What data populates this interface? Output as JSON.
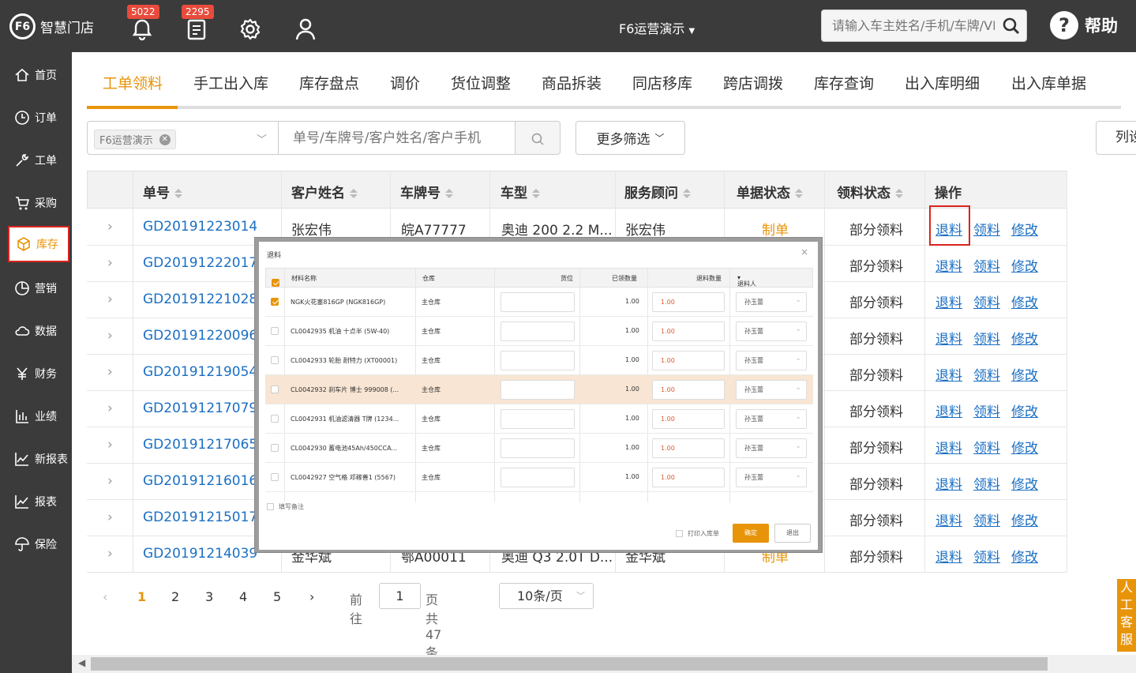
{
  "header": {
    "brand": "智慧门店",
    "brand_mark": "F6",
    "notifications_count": "5022",
    "tasks_count": "2295",
    "store": "F6运营演示",
    "search_placeholder": "请输入车主姓名/手机/车牌/VIN",
    "help_label": "帮助"
  },
  "sidebar": {
    "items": [
      {
        "label": "首页",
        "icon": "home-icon"
      },
      {
        "label": "订单",
        "icon": "clock-icon"
      },
      {
        "label": "工单",
        "icon": "wrench-icon"
      },
      {
        "label": "采购",
        "icon": "cart-icon"
      },
      {
        "label": "库存",
        "icon": "box-icon",
        "active": true
      },
      {
        "label": "营销",
        "icon": "pie-icon"
      },
      {
        "label": "数据",
        "icon": "cloud-icon"
      },
      {
        "label": "财务",
        "icon": "yen-icon"
      },
      {
        "label": "业绩",
        "icon": "bar-chart-icon"
      },
      {
        "label": "新报表",
        "icon": "line-chart-icon"
      },
      {
        "label": "报表",
        "icon": "line-chart-icon"
      },
      {
        "label": "保险",
        "icon": "umbrella-icon"
      }
    ]
  },
  "tabs": [
    "工单领料",
    "手工出入库",
    "库存盘点",
    "调价",
    "货位调整",
    "商品拆装",
    "同店移库",
    "跨店调拨",
    "库存查询",
    "出入库明细",
    "出入库单据"
  ],
  "filters": {
    "store_chip": "F6运营演示",
    "search_placeholder": "单号/车牌号/客户姓名/客户手机",
    "more_label": "更多筛选",
    "columns_label": "列设"
  },
  "table": {
    "headers": [
      "单号",
      "客户姓名",
      "车牌号",
      "车型",
      "服务顾问",
      "单据状态",
      "领料状态",
      "操作"
    ],
    "rows": [
      {
        "order": "GD20191223014",
        "customer": "张宏伟",
        "plate": "皖A77777",
        "model": "奥迪 200 2.2 M...",
        "advisor": "张宏伟",
        "status": "制单",
        "pick": "部分领料"
      },
      {
        "order": "GD20191222017",
        "customer": "",
        "plate": "",
        "model": "",
        "advisor": "",
        "status": "",
        "pick": "部分领料"
      },
      {
        "order": "GD20191221028",
        "customer": "",
        "plate": "",
        "model": "",
        "advisor": "",
        "status": "",
        "pick": "部分领料"
      },
      {
        "order": "GD20191220096",
        "customer": "",
        "plate": "",
        "model": "",
        "advisor": "",
        "status": "",
        "pick": "部分领料"
      },
      {
        "order": "GD20191219054",
        "customer": "",
        "plate": "",
        "model": "",
        "advisor": "",
        "status": "",
        "pick": "部分领料"
      },
      {
        "order": "GD20191217079",
        "customer": "",
        "plate": "",
        "model": "",
        "advisor": "",
        "status": "",
        "pick": "部分领料"
      },
      {
        "order": "GD20191217065",
        "customer": "",
        "plate": "",
        "model": "",
        "advisor": "",
        "status": "",
        "pick": "部分领料"
      },
      {
        "order": "GD20191216016",
        "customer": "",
        "plate": "",
        "model": "",
        "advisor": "",
        "status": "",
        "pick": "部分领料"
      },
      {
        "order": "GD20191215017",
        "customer": "",
        "plate": "",
        "model": "",
        "advisor": "",
        "status": "",
        "pick": "部分领料"
      },
      {
        "order": "GD20191214039",
        "customer": "金华斌",
        "plate": "鄂A00011",
        "model": "奥迪 Q3 2.0T D...",
        "advisor": "金华斌",
        "status": "制单",
        "pick": "部分领料"
      }
    ],
    "actions": [
      "退料",
      "领料",
      "修改"
    ]
  },
  "pagination": {
    "pages": [
      "1",
      "2",
      "3",
      "4",
      "5"
    ],
    "current": "1",
    "goto_label": "前往",
    "goto_value": "1",
    "total_label": "页共 47 条",
    "page_size": "10条/页"
  },
  "customer_service": "人工客服",
  "dialog": {
    "title": "退料",
    "close": "×",
    "headers": [
      "材料名称",
      "仓库",
      "货位",
      "已领数量",
      "退料数量",
      "退料人"
    ],
    "rows": [
      {
        "name": "NGK火花塞816GP (NGK816GP)",
        "warehouse": "主仓库",
        "picked": "1.00",
        "qty": "1.00",
        "person": "孙玉蕾",
        "checked": true
      },
      {
        "name": "CL0042935 机油 十点半 (5W-40)",
        "warehouse": "主仓库",
        "picked": "1.00",
        "qty": "1.00",
        "person": "孙玉蕾",
        "checked": false
      },
      {
        "name": "CL0042933 轮胎 耐特力 (XT00001)",
        "warehouse": "主仓库",
        "picked": "1.00",
        "qty": "1.00",
        "person": "孙玉蕾",
        "checked": false
      },
      {
        "name": "CL0042932 刹车片 博士 999008 (...",
        "warehouse": "主仓库",
        "picked": "1.00",
        "qty": "1.00",
        "person": "孙玉蕾",
        "checked": false
      },
      {
        "name": "CL0042931 机油滤清器 T牌 (1234...",
        "warehouse": "主仓库",
        "picked": "1.00",
        "qty": "1.00",
        "person": "孙玉蕾",
        "checked": false
      },
      {
        "name": "CL0042930 蓄电池45Ah/450CCA...",
        "warehouse": "主仓库",
        "picked": "1.00",
        "qty": "1.00",
        "person": "孙玉蕾",
        "checked": false
      },
      {
        "name": "CL0042927 空气格 邓稼善1 (5567)",
        "warehouse": "主仓库",
        "picked": "1.00",
        "qty": "1.00",
        "person": "孙玉蕾",
        "checked": false
      }
    ],
    "remark_label": "填写备注",
    "print_label": "打印入库单",
    "confirm_label": "确定",
    "exit_label": "退出"
  }
}
